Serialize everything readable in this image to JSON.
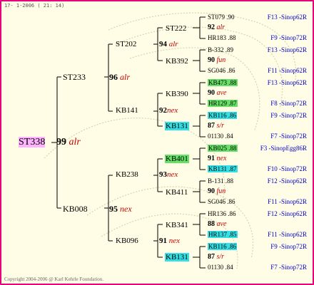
{
  "header": {
    "text": "17- 1-2006 ( 21: 14)"
  },
  "footer": {
    "copyright": "Copyright 2004-2006 @ Karl Kehrle Foundation."
  },
  "root": {
    "name": "ST338",
    "num": "99",
    "score": "alr"
  },
  "gen1": [
    {
      "name": "ST233",
      "num": "96",
      "score": "alr"
    },
    {
      "name": "KB008",
      "num": "95",
      "score": "nex"
    }
  ],
  "gen2": [
    {
      "name": "ST202",
      "num": "94",
      "score": "alr"
    },
    {
      "name": "KB141",
      "num": "92",
      "score": "nex"
    },
    {
      "name": "KB238",
      "num": "93",
      "score": "nex"
    },
    {
      "name": "KB096",
      "num": "91",
      "score": "nex"
    }
  ],
  "gen3": [
    {
      "name": "ST222"
    },
    {
      "name": "KB392"
    },
    {
      "name": "KB390"
    },
    {
      "name": "KB131"
    },
    {
      "name": "KB401"
    },
    {
      "name": "KB411"
    },
    {
      "name": "KB341"
    },
    {
      "name": "KB131"
    }
  ],
  "gen4": [
    {
      "top": "ST079 .90",
      "num": "92",
      "score": "alr",
      "bottom": "HR183 .88",
      "prize_top": "F13 -Sinop62R",
      "prize_bottom": "F9 -Sinop72R"
    },
    {
      "top": "B-332 .89",
      "num": "90",
      "score": "fun",
      "bottom": "SG046 .86",
      "prize_top": "F13 -Sinop62R",
      "prize_bottom": "F11 -Sinop62R"
    },
    {
      "top": "KB473 .88",
      "num": "90",
      "score": "ave",
      "bottom": "HR129 .87",
      "prize_top": "F13 -Sinop62R",
      "prize_bottom": "F8 -Sinop72R"
    },
    {
      "top": "KB116 .86",
      "num": "87",
      "score": "s/r",
      "bottom": "01130 .84",
      "prize_top": "F9 -Sinop72R",
      "prize_bottom": "F7 -Sinop72R"
    },
    {
      "top": "KB025 .88",
      "num": "91",
      "score": "nex",
      "bottom": "KB131 .87",
      "prize_top": "F3 -SinopEgg86R",
      "prize_bottom": "F10 -Sinop72R"
    },
    {
      "top": "B-131 .88",
      "num": "90",
      "score": "fun",
      "bottom": "SG046 .86",
      "prize_top": "F12 -Sinop62R",
      "prize_bottom": "F11 -Sinop62R"
    },
    {
      "top": "HR136 .86",
      "num": "88",
      "score": "ave",
      "bottom": "HR137 .85",
      "prize_top": "F12 -Sinop62R",
      "prize_bottom": "F11 -Sinop62R"
    },
    {
      "top": "KB116 .86",
      "num": "87",
      "score": "s/r",
      "bottom": "01130 .84",
      "prize_top": "F9 -Sinop72R",
      "prize_bottom": "F7 -Sinop72R"
    }
  ],
  "colors": {
    "border": "#e8007a",
    "background": "#fffde6",
    "score": "#cc0000",
    "prize": "#0000cc",
    "root_highlight": "#ffb3ff",
    "cyan_highlight": "#33e0e6",
    "green_highlight": "#66e066"
  }
}
